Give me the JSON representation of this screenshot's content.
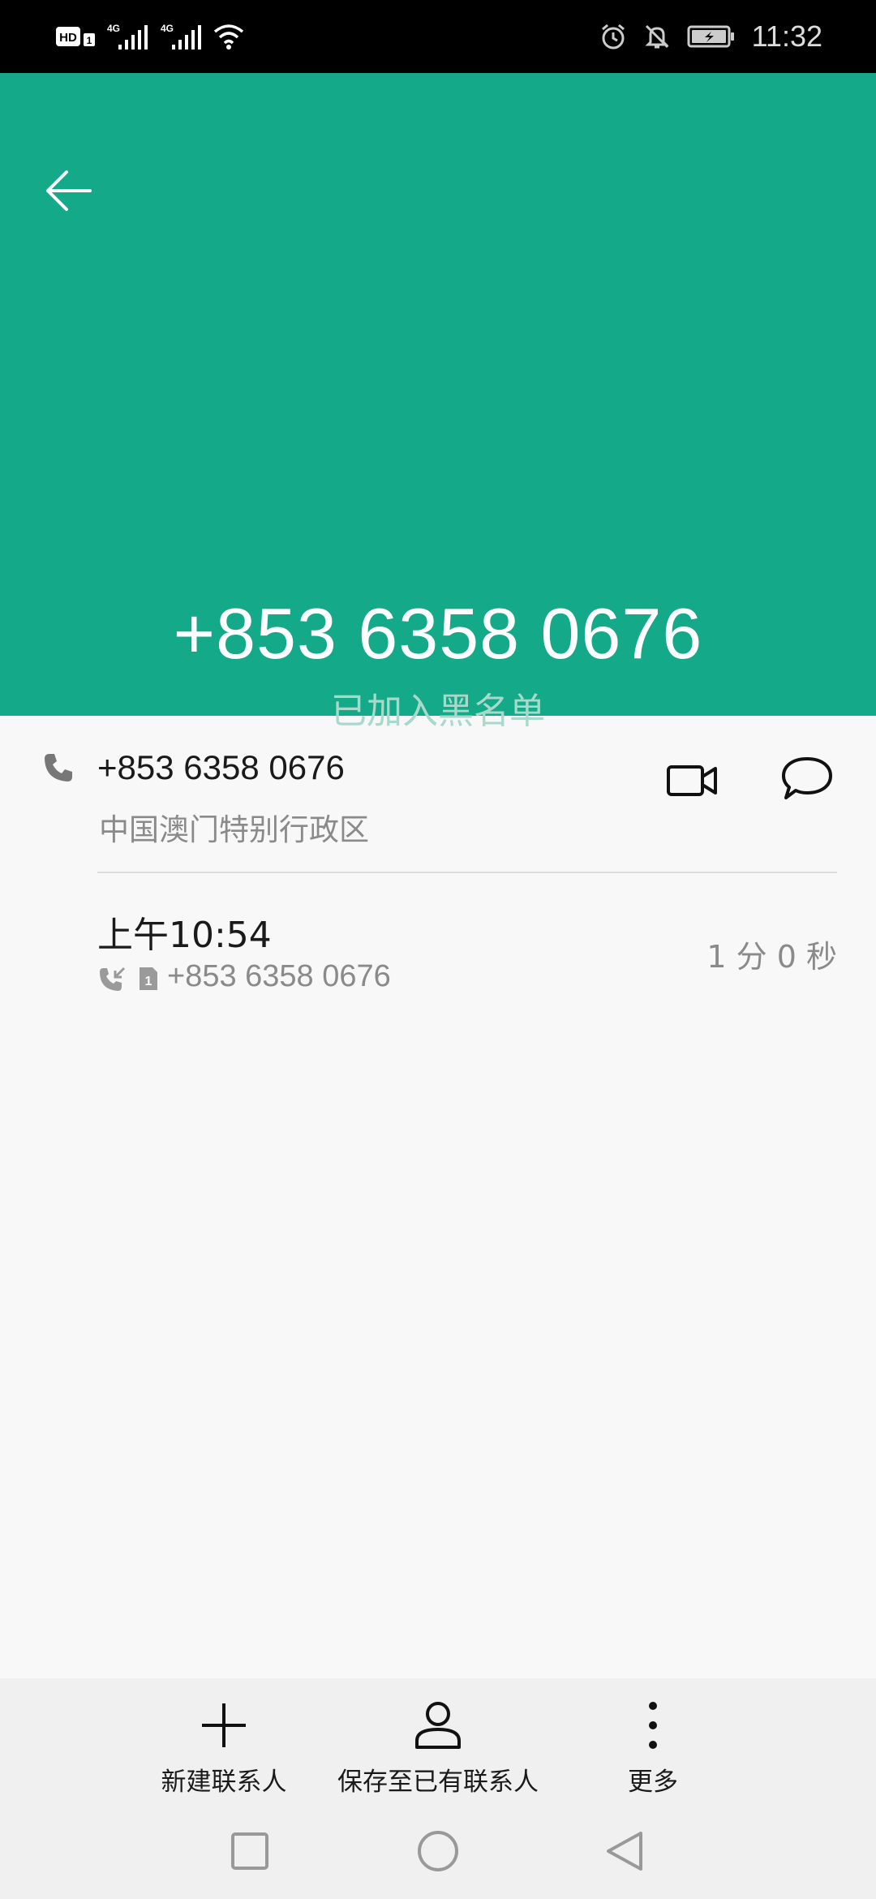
{
  "status_bar": {
    "hd_label": "HD",
    "sim1_label": "1",
    "network_label_1": "4G",
    "network_label_2": "4G",
    "time": "11:32",
    "icons": [
      "hd-icon",
      "signal-icon",
      "signal-icon",
      "wifi-icon",
      "alarm-icon",
      "mute-icon",
      "battery-icon"
    ]
  },
  "header": {
    "back_icon": "arrow-left-icon",
    "phone_number": "+853 6358 0676",
    "status": "已加入黑名单",
    "background_color": "#14a989"
  },
  "number_row": {
    "icon": "phone-icon",
    "number": "+853 6358 0676",
    "region": "中国澳门特别行政区",
    "video_icon": "video-call-icon",
    "message_icon": "message-icon"
  },
  "call_log": [
    {
      "time": "上午10:54",
      "type_icon": "incoming-call-icon",
      "sim_icon": "sim-1-icon",
      "sim_label": "1",
      "number": "+853 6358 0676",
      "duration": "1 分 0 秒"
    }
  ],
  "actions": {
    "new_contact": {
      "label": "新建联系人",
      "icon": "plus-icon"
    },
    "save_to_existing": {
      "label": "保存至已有联系人",
      "icon": "person-icon"
    },
    "more": {
      "label": "更多",
      "icon": "more-vertical-icon"
    }
  },
  "nav_bar": {
    "icons": [
      "recent-apps-icon",
      "home-icon",
      "back-icon"
    ]
  }
}
